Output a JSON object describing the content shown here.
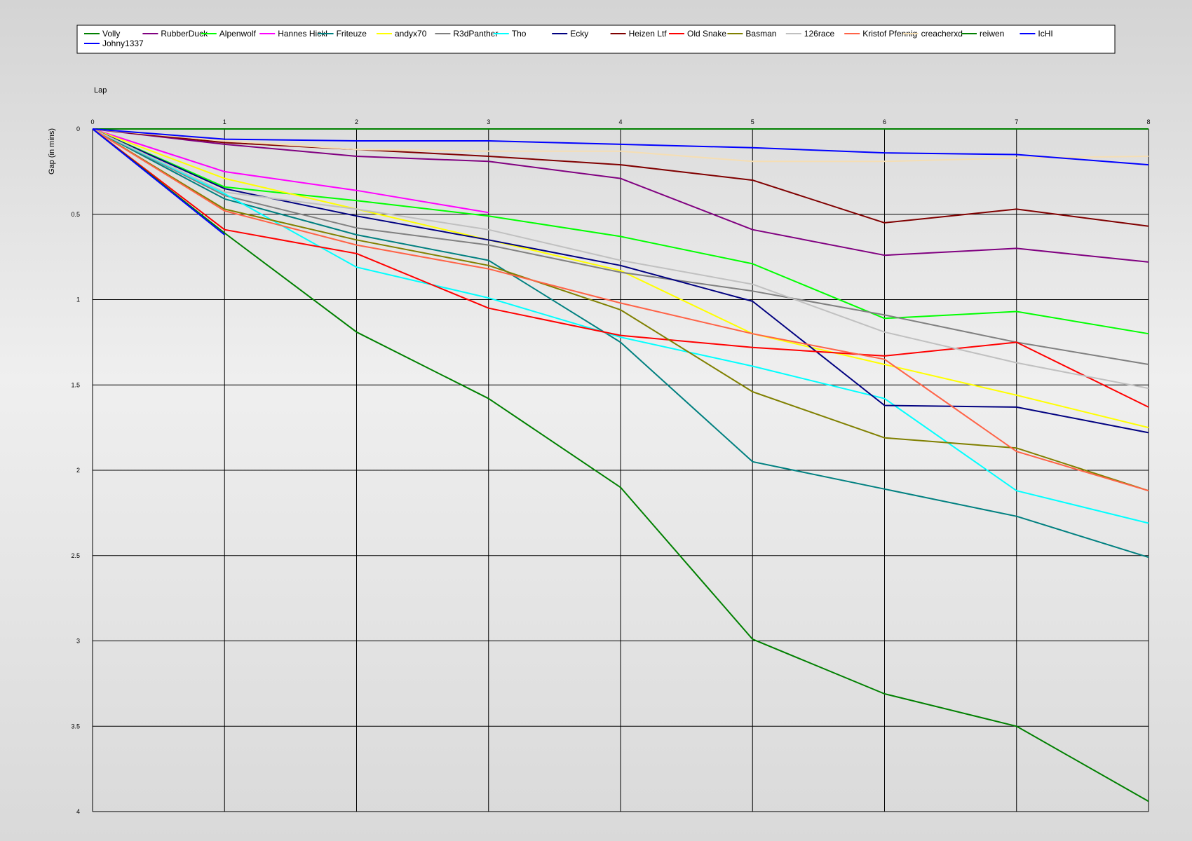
{
  "chart_data": {
    "type": "line",
    "xlabel": "Lap",
    "ylabel": "Gap (in mins)",
    "x": [
      0,
      1,
      2,
      3,
      4,
      5,
      6,
      7,
      8
    ],
    "xlim": [
      0,
      8
    ],
    "ylim": [
      0,
      4
    ],
    "y_inverted": true,
    "yticks": [
      0,
      0.5,
      1,
      1.5,
      2,
      2.5,
      3,
      3.5,
      4
    ],
    "grid": true,
    "legend_position": "top",
    "series": [
      {
        "name": "Volly",
        "color": "#008000",
        "values": [
          0,
          0,
          0,
          0,
          0,
          0,
          0,
          0,
          0
        ]
      },
      {
        "name": "RubberDuck",
        "color": "#800080",
        "values": [
          0,
          0.09,
          0.16,
          0.19,
          0.29,
          0.59,
          0.74,
          0.7,
          0.78
        ]
      },
      {
        "name": "Alpenwolf",
        "color": "#00ff00",
        "values": [
          0,
          0.34,
          0.42,
          0.51,
          0.63,
          0.79,
          1.11,
          1.07,
          1.2
        ]
      },
      {
        "name": "Hannes Hickl",
        "color": "#ff00ff",
        "values": [
          0,
          0.25,
          0.36,
          0.49,
          null,
          null,
          null,
          null,
          null
        ]
      },
      {
        "name": "Friteuze",
        "color": "#008080",
        "values": [
          0,
          0.41,
          0.62,
          0.77,
          1.25,
          1.95,
          2.11,
          2.27,
          2.51
        ]
      },
      {
        "name": "andyx70",
        "color": "#ffff00",
        "values": [
          0,
          0.29,
          0.47,
          0.65,
          0.83,
          1.2,
          1.38,
          1.56,
          1.75
        ]
      },
      {
        "name": "R3dPanther",
        "color": "#808080",
        "values": [
          0,
          0.39,
          0.58,
          0.68,
          0.84,
          0.95,
          1.09,
          1.25,
          1.38
        ]
      },
      {
        "name": "Tho",
        "color": "#00ffff",
        "values": [
          0,
          0.38,
          0.81,
          0.99,
          1.22,
          1.39,
          1.58,
          2.12,
          2.31
        ]
      },
      {
        "name": "Ecky",
        "color": "#000080",
        "values": [
          0,
          0.35,
          0.51,
          0.65,
          0.8,
          1.01,
          1.62,
          1.63,
          1.78
        ]
      },
      {
        "name": "Heizen Ltf",
        "color": "#800000",
        "values": [
          0,
          0.08,
          0.12,
          0.16,
          0.21,
          0.3,
          0.55,
          0.47,
          0.57
        ]
      },
      {
        "name": "Old Snake",
        "color": "#ff0000",
        "values": [
          0,
          0.59,
          0.73,
          1.05,
          1.21,
          1.28,
          1.33,
          1.25,
          1.63
        ]
      },
      {
        "name": "Basman",
        "color": "#808000",
        "values": [
          0,
          0.47,
          0.65,
          0.8,
          1.06,
          1.54,
          1.81,
          1.87,
          2.12
        ]
      },
      {
        "name": "126race",
        "color": "#c0c0c0",
        "values": [
          0,
          0.37,
          0.47,
          0.59,
          0.77,
          0.91,
          1.19,
          1.37,
          1.52
        ]
      },
      {
        "name": "Kristof Pfennig",
        "color": "#ff6347",
        "values": [
          0,
          0.48,
          0.68,
          0.82,
          1.02,
          1.2,
          1.35,
          1.89,
          2.12
        ]
      },
      {
        "name": "creacherxd",
        "color": "#f5deb3",
        "values": [
          0,
          0.07,
          0.12,
          0.13,
          0.13,
          0.19,
          0.19,
          0.17,
          0.16
        ]
      },
      {
        "name": "reiwen",
        "color": "#008000",
        "values": [
          0,
          0.61,
          1.19,
          1.58,
          2.1,
          2.99,
          3.31,
          3.5,
          3.94
        ]
      },
      {
        "name": "IcHI",
        "color": "#0000ff",
        "values": [
          0,
          0.06,
          0.07,
          0.07,
          0.09,
          0.11,
          0.14,
          0.15,
          0.21
        ]
      },
      {
        "name": "Johny1337",
        "color": "#0000ff",
        "values": [
          0,
          0.62,
          null,
          null,
          null,
          null,
          null,
          null,
          null
        ]
      }
    ]
  }
}
